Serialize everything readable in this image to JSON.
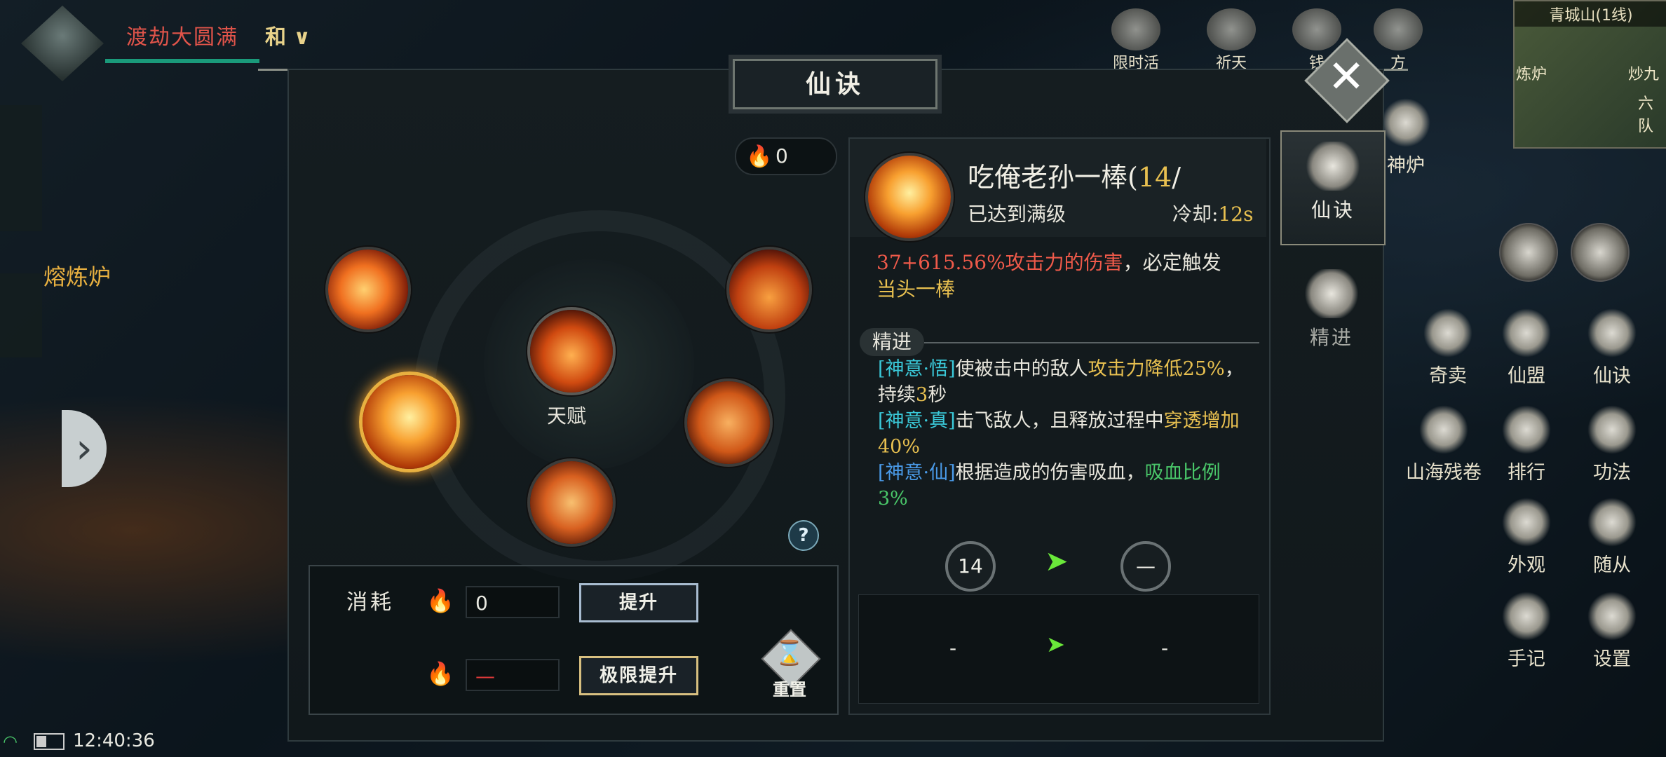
{
  "hud": {
    "player_title": "渡劫大圆满",
    "peace_mode": "和",
    "furnace_label": "熔炼炉",
    "time": "12:40:36"
  },
  "top_icons": [
    {
      "label": "限时活动",
      "icon": "mask-icon"
    },
    {
      "label": "祈天",
      "icon": "altar-icon"
    },
    {
      "label": "钱",
      "icon": "coin-icon"
    },
    {
      "label": "方",
      "icon": "pavilion-icon"
    }
  ],
  "minimap": {
    "title": "青城山(1线)",
    "labels": [
      "炼炉",
      "炒九",
      "六队"
    ]
  },
  "right_menu": [
    {
      "label": "神炉",
      "icon": "furnace-icon"
    },
    {
      "label": "奇卖",
      "icon": "coin-icon"
    },
    {
      "label": "仙盟",
      "icon": "banner-icon"
    },
    {
      "label": "仙诀",
      "icon": "scroll-icon"
    },
    {
      "label": "山海残卷",
      "icon": "scroll-icon"
    },
    {
      "label": "排行",
      "icon": "rank-icon"
    },
    {
      "label": "功法",
      "icon": "yin-yang-icon"
    },
    {
      "label": "外观",
      "icon": "helmet-icon"
    },
    {
      "label": "随从",
      "icon": "companion-icon"
    },
    {
      "label": "手记",
      "icon": "notebook-icon"
    },
    {
      "label": "设置",
      "icon": "gear-icon"
    }
  ],
  "dialog": {
    "title": "仙诀",
    "essence_count": "0",
    "talent_label": "天赋",
    "cost": {
      "label": "消耗",
      "value": "0",
      "limit_value": "—",
      "upgrade_button": "提升",
      "limit_upgrade_button": "极限提升",
      "reset_label": "重置"
    },
    "skill": {
      "name": "吃俺老孙一棒(",
      "level": "14",
      "level_suffix": "/",
      "max_level_text": "已达到满级",
      "cooldown_label": "冷却:",
      "cooldown_value": "12s",
      "desc_damage": "37+615.56%攻击力的伤害",
      "desc_mid": "，必定触发",
      "desc_effect": "当头一棒",
      "refine_label": "精进",
      "refinements": [
        {
          "tag": "[神意·悟]",
          "text1": "使被击中的敌人",
          "hl1": "攻击力降低25%",
          "text2": "，持续",
          "hl2": "3",
          "text3": "秒"
        },
        {
          "tag": "[神意·真]",
          "text1": "击飞敌人，且释放过程中",
          "hl1": "穿透增加40%",
          "text2": "",
          "hl2": "",
          "text3": ""
        },
        {
          "tag": "[神意·仙]",
          "text1": "根据造成的伤害吸血，",
          "hl1": "吸血比例3%",
          "text2": "",
          "hl2": "",
          "text3": ""
        }
      ],
      "current_level": "14",
      "next_level": "—",
      "compare_current": "-",
      "compare_next": "-"
    },
    "tabs": [
      {
        "label": "仙诀",
        "active": true
      },
      {
        "label": "精进",
        "active": false
      }
    ]
  },
  "colors": {
    "damage_red": "#f05a4a",
    "highlight_gold": "#e8c050",
    "tag_cyan": "#3ac8d8",
    "tag_blue": "#4a9ae8",
    "green": "#4ac86a"
  }
}
